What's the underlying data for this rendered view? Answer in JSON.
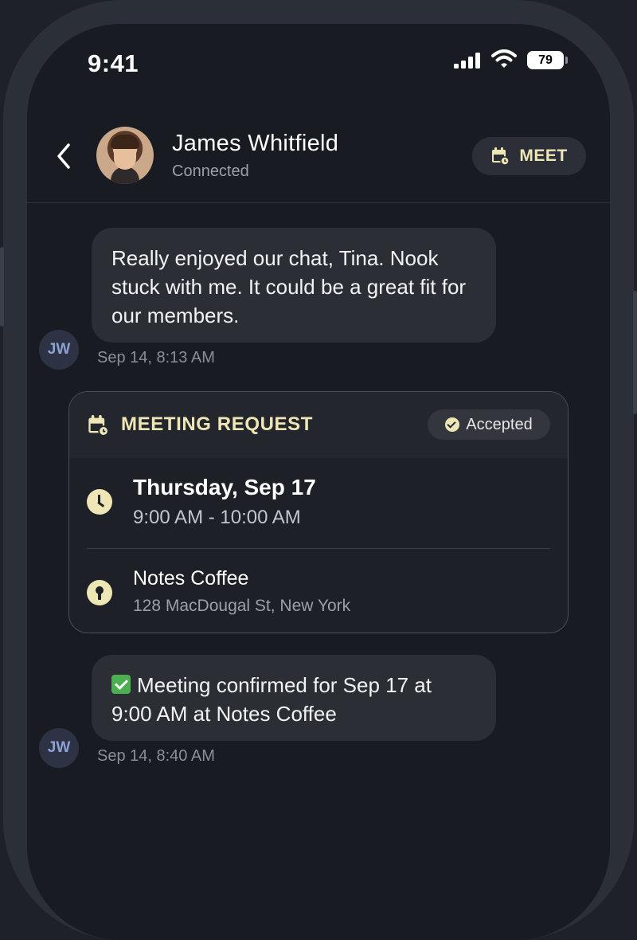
{
  "status_bar": {
    "time": "9:41",
    "battery": "79"
  },
  "header": {
    "contact_name": "James Whitfield",
    "status": "Connected",
    "meet_label": "MEET"
  },
  "messages": [
    {
      "text": "Really enjoyed our chat, Tina. Nook stuck with me. It could be a great fit for our members.",
      "sender_initials": "JW",
      "timestamp": "Sep 14, 8:13 AM"
    },
    {
      "text": "Meeting confirmed for Sep 17 at 9:00 AM at Notes Coffee",
      "sender_initials": "JW",
      "timestamp": "Sep 14, 8:40 AM"
    }
  ],
  "meeting_card": {
    "title": "MEETING REQUEST",
    "status": "Accepted",
    "day": "Thursday, Sep 17",
    "hours": "9:00 AM - 10:00 AM",
    "place": "Notes Coffee",
    "address": "128 MacDougal St, New York"
  },
  "colors": {
    "accent": "#eee7b5",
    "background": "#181b21",
    "bubble": "#2b2e35",
    "initials_text": "#8fa1d4"
  },
  "icons": [
    "back-chevron-icon",
    "calendar-icon",
    "check-circle-icon",
    "clock-icon",
    "location-pin-icon",
    "checkmark-emoji-icon",
    "signal-icon",
    "wifi-icon",
    "battery-icon"
  ]
}
